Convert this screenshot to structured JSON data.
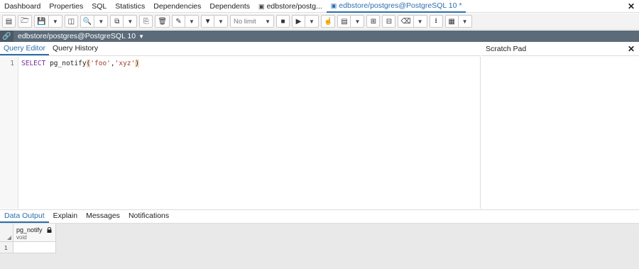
{
  "tabs": [
    {
      "label": "Dashboard"
    },
    {
      "label": "Properties"
    },
    {
      "label": "SQL"
    },
    {
      "label": "Statistics"
    },
    {
      "label": "Dependencies"
    },
    {
      "label": "Dependents"
    },
    {
      "label": "edbstore/postg..."
    },
    {
      "label": "edbstore/postgres@PostgreSQL 10 *"
    }
  ],
  "toolbar": {
    "limit_value": "No limit"
  },
  "connection": {
    "label": "edbstore/postgres@PostgreSQL 10"
  },
  "editor": {
    "tabs": [
      {
        "label": "Query Editor"
      },
      {
        "label": "Query History"
      }
    ],
    "line_number": "1",
    "code": {
      "keyword": "SELECT",
      "function": "pg_notify",
      "open_paren": "(",
      "arg1": "'foo'",
      "comma": ",",
      "arg2": "'xyz'",
      "close_paren": ")"
    }
  },
  "scratch_pad": {
    "title": "Scratch Pad"
  },
  "output": {
    "tabs": [
      {
        "label": "Data Output"
      },
      {
        "label": "Explain"
      },
      {
        "label": "Messages"
      },
      {
        "label": "Notifications"
      }
    ],
    "columns": [
      {
        "name": "pg_notify",
        "type": "void"
      }
    ],
    "rows": [
      {
        "num": "1",
        "value": ""
      }
    ]
  },
  "colors": {
    "accent": "#2c6fad",
    "connection_bar": "#5b6b79"
  }
}
